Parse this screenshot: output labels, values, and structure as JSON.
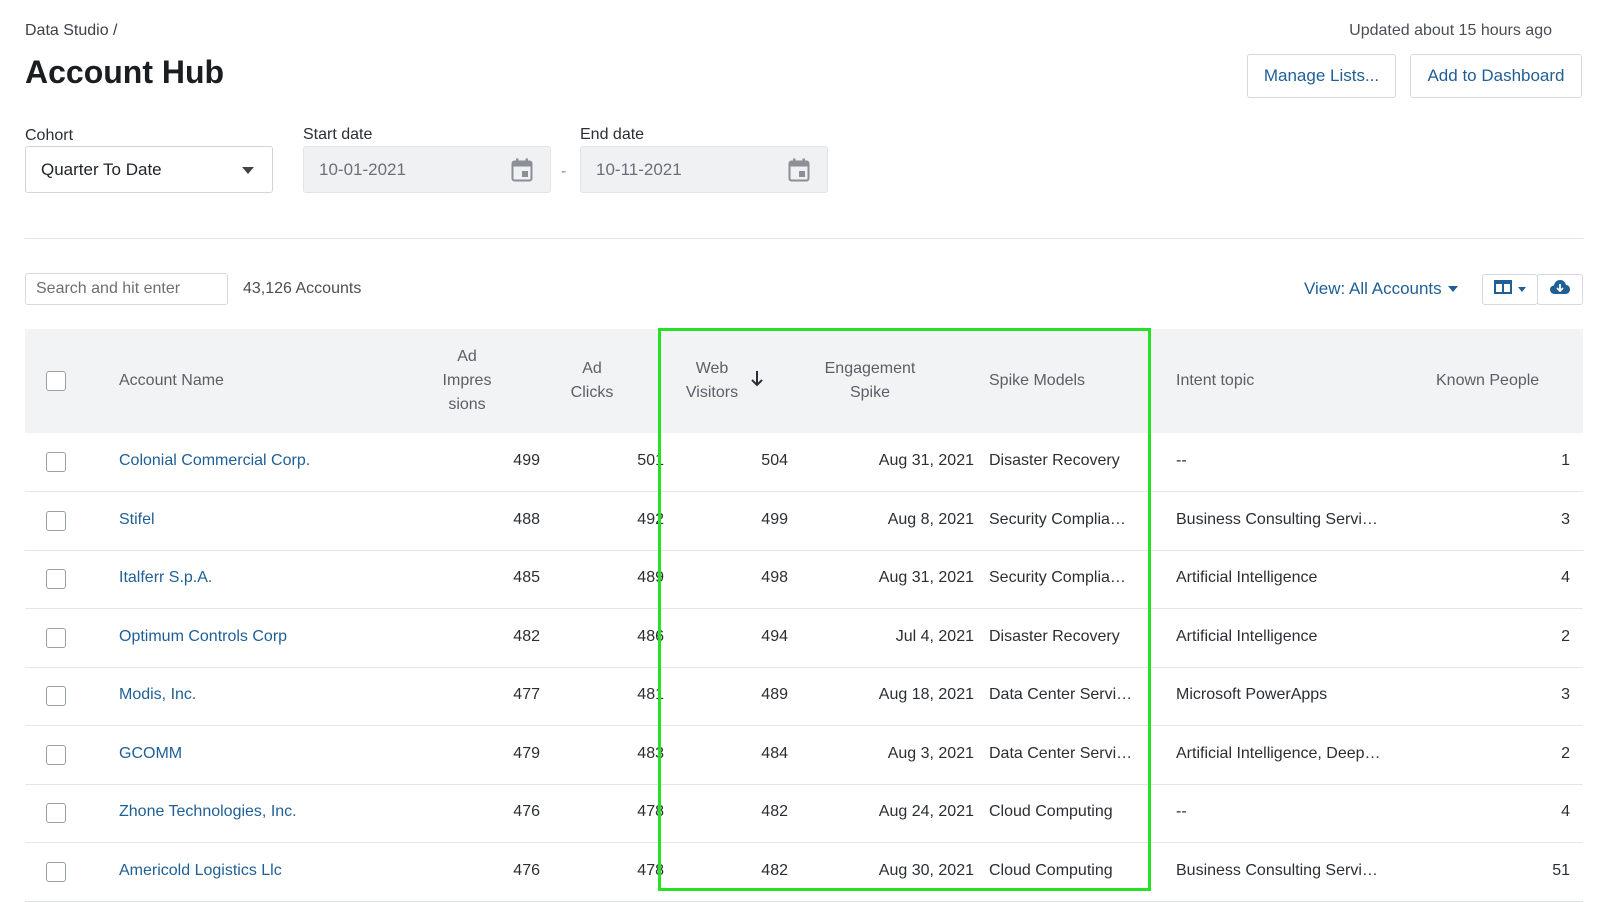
{
  "breadcrumb": "Data Studio /",
  "page_title": "Account Hub",
  "updated": "Updated about 15 hours ago",
  "buttons": {
    "manage_lists": "Manage Lists...",
    "add_dashboard": "Add to Dashboard"
  },
  "filters": {
    "cohort_label": "Cohort",
    "cohort_value": "Quarter To Date",
    "start_label": "Start date",
    "start_value": "10-01-2021",
    "end_label": "End date",
    "end_value": "10-11-2021",
    "separator": "-"
  },
  "toolbar": {
    "search_placeholder": "Search and hit enter",
    "accounts_count": "43,126 Accounts",
    "view_label": "View: All Accounts"
  },
  "columns": {
    "account_name": "Account Name",
    "ad_impressions": [
      "Ad",
      "Impres",
      "sions"
    ],
    "ad_clicks": [
      "Ad",
      "Clicks"
    ],
    "web_visitors": [
      "Web",
      "Visitors"
    ],
    "engagement_spike": [
      "Engagement",
      "Spike"
    ],
    "spike_models": "Spike Models",
    "intent_topic": "Intent topic",
    "known_people": "Known People"
  },
  "rows": [
    {
      "name": "Colonial Commercial Corp.",
      "impressions": "499",
      "clicks": "501",
      "visitors": "504",
      "spike": "Aug 31, 2021",
      "models": "Disaster Recovery",
      "intent": "--",
      "known": "1"
    },
    {
      "name": "Stifel",
      "impressions": "488",
      "clicks": "492",
      "visitors": "499",
      "spike": "Aug 8, 2021",
      "models": "Security Complia…",
      "intent": "Business Consulting Servi…",
      "known": "3"
    },
    {
      "name": "Italferr S.p.A.",
      "impressions": "485",
      "clicks": "489",
      "visitors": "498",
      "spike": "Aug 31, 2021",
      "models": "Security Complia…",
      "intent": "Artificial Intelligence",
      "known": "4"
    },
    {
      "name": "Optimum Controls Corp",
      "impressions": "482",
      "clicks": "486",
      "visitors": "494",
      "spike": "Jul 4, 2021",
      "models": "Disaster Recovery",
      "intent": "Artificial Intelligence",
      "known": "2"
    },
    {
      "name": "Modis, Inc.",
      "impressions": "477",
      "clicks": "481",
      "visitors": "489",
      "spike": "Aug 18, 2021",
      "models": "Data Center Servi…",
      "intent": "Microsoft PowerApps",
      "known": "3"
    },
    {
      "name": "GCOMM",
      "impressions": "479",
      "clicks": "483",
      "visitors": "484",
      "spike": "Aug 3, 2021",
      "models": "Data Center Servi…",
      "intent": "Artificial Intelligence, Deep…",
      "known": "2"
    },
    {
      "name": "Zhone Technologies, Inc.",
      "impressions": "476",
      "clicks": "478",
      "visitors": "482",
      "spike": "Aug 24, 2021",
      "models": "Cloud Computing",
      "intent": "--",
      "known": "4"
    },
    {
      "name": "Americold Logistics Llc",
      "impressions": "476",
      "clicks": "478",
      "visitors": "482",
      "spike": "Aug 30, 2021",
      "models": "Cloud Computing",
      "intent": "Business Consulting Servi…",
      "known": "51"
    }
  ],
  "colors": {
    "link": "#1f5f96",
    "highlight": "#27e127",
    "header_bg": "#f1f3f5"
  },
  "icons": [
    "calendar-icon",
    "chevron-down-icon",
    "sort-down-icon",
    "columns-icon",
    "cloud-download-icon"
  ]
}
